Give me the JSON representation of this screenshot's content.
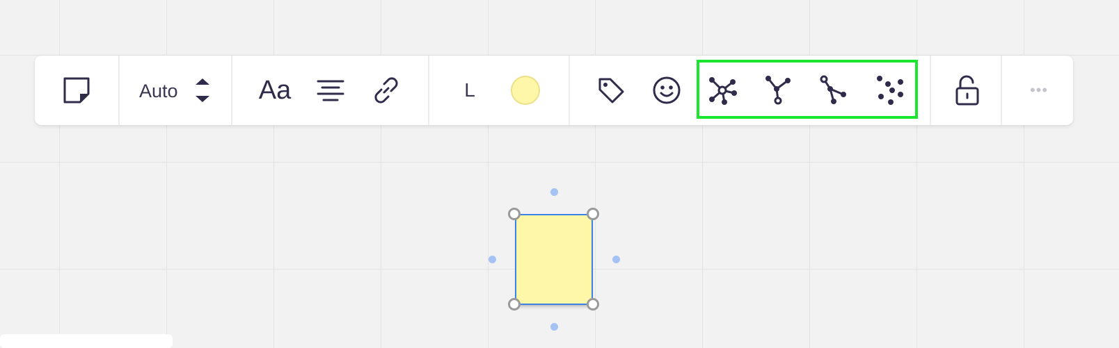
{
  "toolbar": {
    "font_size_label": "Auto",
    "text_size_label": "L",
    "text_style_label": "Aa",
    "more_label": "•••",
    "sticky_color": "#fff7a8",
    "highlight_color": "#19e62c"
  },
  "icons": [
    "sticky-note-icon",
    "stepper-icon",
    "text-style-icon",
    "align-center-icon",
    "link-icon",
    "color-swatch",
    "tag-icon",
    "emoji-icon",
    "cluster-network-icon",
    "merge-branch-icon",
    "split-branch-icon",
    "scatter-dots-icon",
    "unlock-icon",
    "more-icon"
  ]
}
